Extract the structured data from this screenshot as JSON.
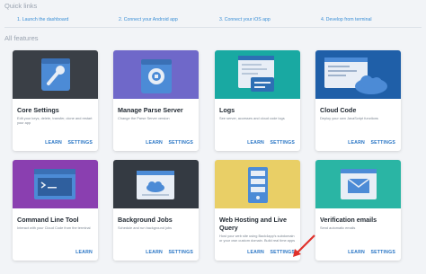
{
  "quick_links": {
    "heading": "Quick links",
    "items": [
      {
        "label": "1. Launch the dashboard"
      },
      {
        "label": "2. Connect your Android app"
      },
      {
        "label": "3. Connect your iOS app"
      },
      {
        "label": "4. Develop from terminal"
      }
    ]
  },
  "features": {
    "heading": "All features",
    "cards": [
      {
        "title": "Core Settings",
        "description": "Edit your keys, delete, transfer, clone and restart your app",
        "learn": "LEARN",
        "settings": "SETTINGS",
        "color": "#3a3f46",
        "icon": "wrench-icon"
      },
      {
        "title": "Manage Parse Server",
        "description": "Change the Parse Server version",
        "learn": "LEARN",
        "settings": "SETTINGS",
        "color": "#6f68c9",
        "icon": "parse-server-icon"
      },
      {
        "title": "Logs",
        "description": "See server, accesses and cloud code logs",
        "learn": "LEARN",
        "settings": "SETTINGS",
        "color": "#19a9a2",
        "icon": "logs-icon"
      },
      {
        "title": "Cloud Code",
        "description": "Deploy your own JavaScript functions",
        "learn": "LEARN",
        "settings": "SETTINGS",
        "color": "#1f5fa8",
        "icon": "cloud-code-icon"
      },
      {
        "title": "Command Line Tool",
        "description": "Interact with your Cloud Code from the terminal",
        "learn": "LEARN",
        "settings": "",
        "color": "#8a3fb0",
        "icon": "terminal-icon"
      },
      {
        "title": "Background Jobs",
        "description": "Schedule and run background jobs",
        "learn": "LEARN",
        "settings": "SETTINGS",
        "color": "#343a42",
        "icon": "background-jobs-icon"
      },
      {
        "title": "Web Hosting and Live Query",
        "description": "Host your web site using Back4app's subdomain or your own custom domain. Build real time apps",
        "learn": "LEARN",
        "settings": "SETTINGS",
        "color": "#e9cf66",
        "icon": "server-icon"
      },
      {
        "title": "Verification emails",
        "description": "Send automatic emails",
        "learn": "LEARN",
        "settings": "SETTINGS",
        "color": "#2ab5a4",
        "icon": "envelope-icon"
      }
    ]
  }
}
